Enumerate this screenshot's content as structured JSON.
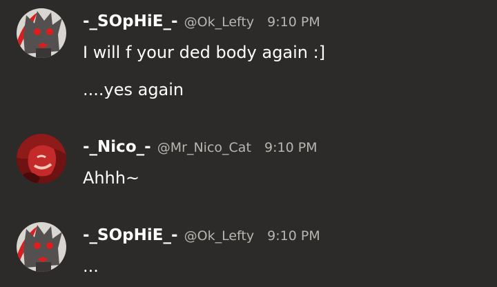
{
  "messages": [
    {
      "display_name": "-_SOpHiE_-",
      "handle": "@Ok_Lefty",
      "time": "9:10 PM",
      "avatar": "wolf-avatar-icon",
      "lines": [
        "I will f your ded body again :]",
        "....yes again"
      ]
    },
    {
      "display_name": "-_Nico_-",
      "handle": "@Mr_Nico_Cat",
      "time": "9:10 PM",
      "avatar": "red-character-avatar-icon",
      "lines": [
        "Ahhh~"
      ]
    },
    {
      "display_name": "-_SOpHiE_-",
      "handle": "@Ok_Lefty",
      "time": "9:10 PM",
      "avatar": "wolf-avatar-icon",
      "lines": [
        "..."
      ]
    }
  ],
  "colors": {
    "background": "#2d2b29",
    "name": "#ffffff",
    "meta": "#b9b5b1",
    "text": "#ffffff"
  }
}
